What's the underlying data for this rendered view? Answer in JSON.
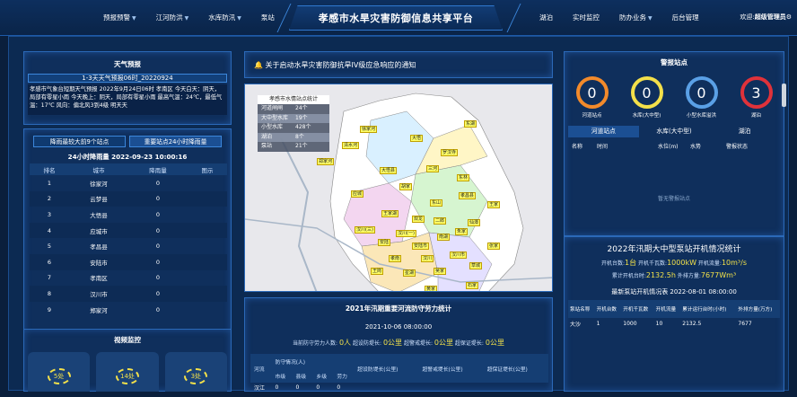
{
  "header": {
    "title": "孝感市水旱灾害防御信息共享平台",
    "nav_left": [
      {
        "label": "预报预警",
        "dropdown": true
      },
      {
        "label": "江河防洪",
        "dropdown": true
      },
      {
        "label": "水库防汛",
        "dropdown": true
      },
      {
        "label": "泵站",
        "dropdown": false
      }
    ],
    "nav_right": [
      {
        "label": "湖泊",
        "dropdown": false
      },
      {
        "label": "实时监控",
        "dropdown": false
      },
      {
        "label": "防办业务",
        "dropdown": true
      },
      {
        "label": "后台管理",
        "dropdown": false
      }
    ],
    "welcome_prefix": "欢迎:",
    "welcome_user": "超级管理员"
  },
  "weather": {
    "title": "天气预报",
    "date_label": "1-3天天气预报06时_20220924",
    "text": "孝感市气象台短期天气预报 2022年9月24日06时 孝南区 今天白天：阴天，局部有零星小雨 今天晚上：阴天，局部有零星小雨 最高气温：24℃，最低气温：17℃ 风向：偏北风3到4级 明天天"
  },
  "rain": {
    "tab_active": "降雨最较大前9个站点",
    "tab_other": "重要站点24小时降雨量",
    "subtitle": "24小时降雨量 2022-09-23 10:00:16",
    "columns": [
      "排名",
      "城市",
      "降雨量",
      "图示"
    ],
    "rows": [
      {
        "rank": "1",
        "city": "徐家河",
        "value": "0"
      },
      {
        "rank": "2",
        "city": "云梦县",
        "value": "0"
      },
      {
        "rank": "3",
        "city": "大悟县",
        "value": "0"
      },
      {
        "rank": "4",
        "city": "应城市",
        "value": "0"
      },
      {
        "rank": "5",
        "city": "孝昌县",
        "value": "0"
      },
      {
        "rank": "6",
        "city": "安陆市",
        "value": "0"
      },
      {
        "rank": "7",
        "city": "孝南区",
        "value": "0"
      },
      {
        "rank": "8",
        "city": "汉川市",
        "value": "0"
      },
      {
        "rank": "9",
        "city": "郑家河",
        "value": "0"
      }
    ]
  },
  "video": {
    "title": "视频监控",
    "cards": [
      "5处",
      "14处",
      "3处"
    ]
  },
  "notice": {
    "text": "关于启动水旱灾害防御抗旱IV级应急响应的通知"
  },
  "map": {
    "legend_title": "孝感市水情站点统计",
    "legend": [
      {
        "k": "河道闸闸",
        "v": "24个"
      },
      {
        "k": "大中型水库",
        "v": "19个"
      },
      {
        "k": "小型水库",
        "v": "428个"
      },
      {
        "k": "湖泊",
        "v": "8个"
      },
      {
        "k": "泵站",
        "v": "21个"
      }
    ],
    "labels": [
      "徐家河",
      "清水河",
      "郑家河",
      "东湖",
      "大悟",
      "大悟县",
      "罗汉寺",
      "东林",
      "三河",
      "胡家",
      "应城",
      "孝昌县",
      "东山",
      "王家湖",
      "双龙",
      "二郎",
      "汉川(三)",
      "汉川(一)",
      "安陆",
      "安陆市",
      "南湖",
      "朱家",
      "孝南",
      "汉川",
      "汉川市",
      "仙潭",
      "王岗",
      "星湖",
      "吴家",
      "草城",
      "张家",
      "王家",
      "黄家",
      "石家"
    ]
  },
  "staff": {
    "title": "2021年汛期重要河流防守劳力统计",
    "date": "2021-10-06 08:00:00",
    "line_a_label": "当前防守劳力人数:",
    "line_a_value": "0人",
    "line_b_label": "超设防堤长:",
    "line_b_value": "0公里",
    "line_c_label": "超警戒堤长:",
    "line_c_value": "0公里",
    "line_d_label": "超保证堤长:",
    "line_d_value": "0公里",
    "col_river": "河流",
    "col_group": "防守情况(人)",
    "col_sub": [
      "市级",
      "县级",
      "乡级",
      "劳力"
    ],
    "col_over": [
      "超设防堤长(公里)",
      "超警戒堤长(公里)",
      "超保证堤长(公里)"
    ],
    "first_row": [
      "汉江",
      "0",
      "0",
      "0",
      "0"
    ]
  },
  "warning": {
    "title": "警报站点",
    "circles": [
      {
        "value": "0",
        "label": "河道站点",
        "color": "#f28a2b"
      },
      {
        "value": "0",
        "label": "水库(大中型)",
        "color": "#f3e04a"
      },
      {
        "value": "0",
        "label": "小型水库溢洪",
        "color": "#5aa0e6"
      },
      {
        "value": "3",
        "label": "湖泊",
        "color": "#e0323a"
      }
    ],
    "tabs": [
      "河道站点",
      "水库(大中型)",
      "湖泊"
    ],
    "columns": [
      "名称",
      "时间",
      "水位(m)",
      "水势",
      "警报状态"
    ],
    "empty": "暂无警报站点"
  },
  "pump": {
    "title": "2022年汛期大中型泵站开机情况统计",
    "open_label": "开机台数:",
    "open_value": "1台",
    "kw_label": "开机千瓦数:",
    "kw_value": "1000kW",
    "flow_label": "开机流量:",
    "flow_value": "10m³/s",
    "hours_label": "累计开机台时:",
    "hours_value": "2132.5h",
    "out_label": "外排方量:",
    "out_value": "7677Wm³",
    "sub_title": "最新泵站开机情况表 2022-08-01 08:00:00",
    "columns": [
      "泵站名称",
      "开机台数",
      "开机千瓦数",
      "开机流量",
      "累计运行台时(小时)",
      "外排方量(万方)"
    ],
    "rows": [
      [
        "大沙",
        "1",
        "1000",
        "10",
        "2132.5",
        "7677"
      ]
    ]
  }
}
